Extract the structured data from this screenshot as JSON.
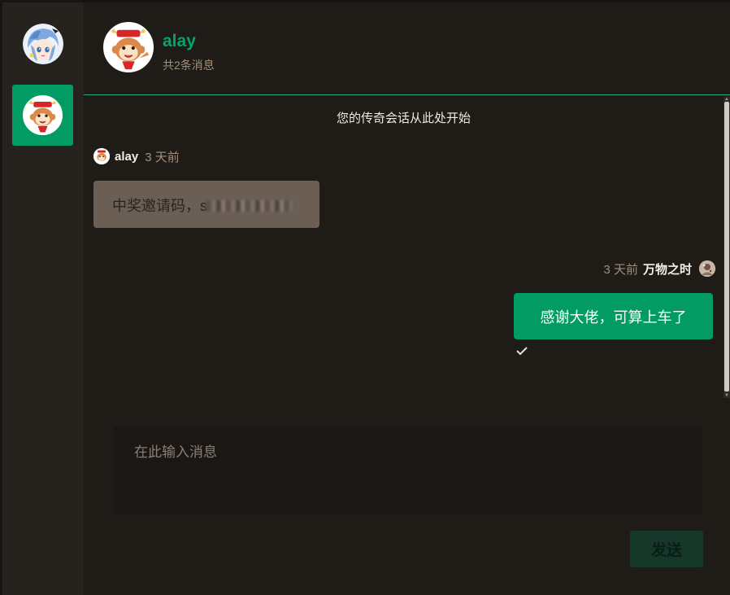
{
  "sidebar": {
    "self_avatar_icon": "anime-girl-avatar-icon",
    "contacts": [
      {
        "avatar_icon": "monkey-cartoon-avatar-icon",
        "active": true
      }
    ]
  },
  "header": {
    "name": "alay",
    "subtitle": "共2条消息"
  },
  "conversation": {
    "start_note": "您的传奇会话从此处开始",
    "messages": [
      {
        "side": "left",
        "sender": "alay",
        "time": "3 天前",
        "text": "中奖邀请码，s"
      },
      {
        "side": "right",
        "sender": "万物之时",
        "time": "3 天前",
        "text": "感谢大佬，可算上车了",
        "status_icon": "check-icon"
      }
    ]
  },
  "composer": {
    "placeholder": "在此输入消息",
    "send_label": "发送"
  },
  "colors": {
    "accent": "#029b64",
    "background": "#1f1b17",
    "sidebar": "#26221e",
    "left_bubble": "#6b5f55",
    "muted_text": "#a08f7c"
  }
}
